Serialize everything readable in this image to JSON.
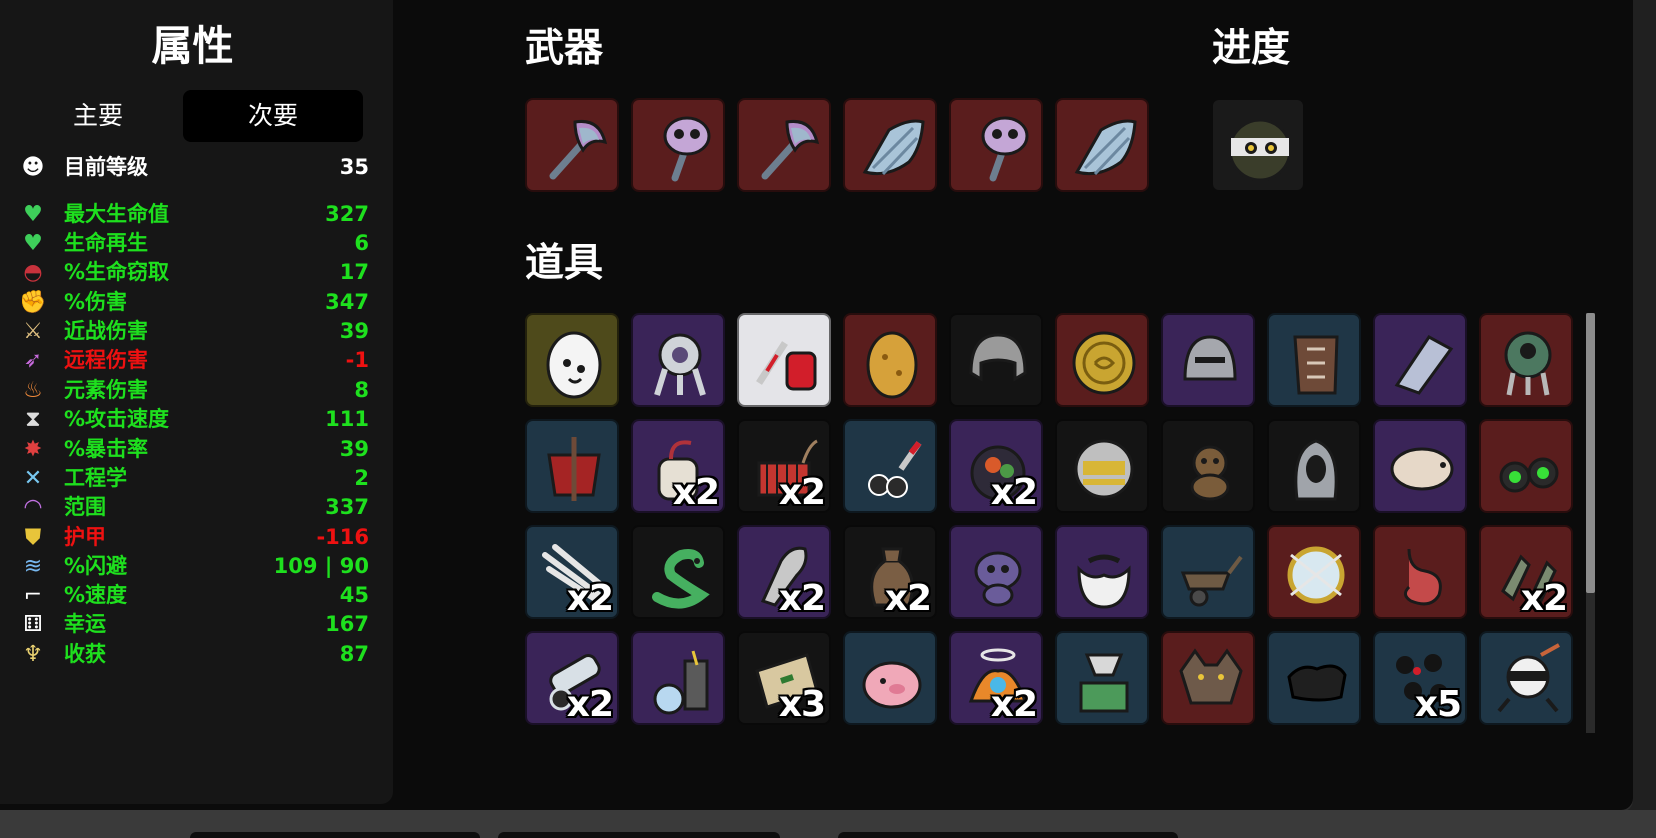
{
  "stats": {
    "title": "属性",
    "tabs": {
      "primary": "主要",
      "secondary": "次要"
    },
    "rows": [
      {
        "label": "目前等级",
        "value": "35",
        "color": "#ffffff",
        "value_color": "#ffffff",
        "icon": "level-up-icon"
      },
      {
        "label": "最大生命值",
        "value": "327",
        "color": "#1ee01e",
        "value_color": "#1ee01e",
        "icon": "heart-icon"
      },
      {
        "label": "生命再生",
        "value": "6",
        "color": "#1ee01e",
        "value_color": "#1ee01e",
        "icon": "heart-plus-icon"
      },
      {
        "label": "%生命窃取",
        "value": "17",
        "color": "#1ee01e",
        "value_color": "#1ee01e",
        "icon": "fangs-icon"
      },
      {
        "label": "%伤害",
        "value": "347",
        "color": "#1ee01e",
        "value_color": "#1ee01e",
        "icon": "fist-icon"
      },
      {
        "label": "近战伤害",
        "value": "39",
        "color": "#1ee01e",
        "value_color": "#1ee01e",
        "icon": "sword-icon"
      },
      {
        "label": "远程伤害",
        "value": "-1",
        "color": "#ee1111",
        "value_color": "#ee1111",
        "icon": "bow-icon"
      },
      {
        "label": "元素伤害",
        "value": "8",
        "color": "#1ee01e",
        "value_color": "#1ee01e",
        "icon": "flame-icon"
      },
      {
        "label": "%攻击速度",
        "value": "111",
        "color": "#1ee01e",
        "value_color": "#1ee01e",
        "icon": "hourglass-icon"
      },
      {
        "label": "%暴击率",
        "value": "39",
        "color": "#1ee01e",
        "value_color": "#1ee01e",
        "icon": "crit-burst-icon"
      },
      {
        "label": "工程学",
        "value": "2",
        "color": "#1ee01e",
        "value_color": "#1ee01e",
        "icon": "wrench-icon"
      },
      {
        "label": "范围",
        "value": "337",
        "color": "#1ee01e",
        "value_color": "#1ee01e",
        "icon": "range-waves-icon"
      },
      {
        "label": "护甲",
        "value": "-116",
        "color": "#ee1111",
        "value_color": "#ee1111",
        "icon": "shield-icon"
      },
      {
        "label": "%闪避",
        "value": "109 | 90",
        "color": "#1ee01e",
        "value_color": "#1ee01e",
        "icon": "dodge-wind-icon"
      },
      {
        "label": "%速度",
        "value": "45",
        "color": "#1ee01e",
        "value_color": "#1ee01e",
        "icon": "boot-icon"
      },
      {
        "label": "幸运",
        "value": "167",
        "color": "#1ee01e",
        "value_color": "#1ee01e",
        "icon": "dice-icon"
      },
      {
        "label": "收获",
        "value": "87",
        "color": "#1ee01e",
        "value_color": "#1ee01e",
        "icon": "harvest-wheat-icon"
      }
    ]
  },
  "weapons": {
    "title": "武器",
    "items": [
      {
        "icon": "axe-icon",
        "tier_color": "#5a1d1d"
      },
      {
        "icon": "skull-mace-icon",
        "tier_color": "#5a1d1d"
      },
      {
        "icon": "axe-icon",
        "tier_color": "#5a1d1d"
      },
      {
        "icon": "crystal-shard-icon",
        "tier_color": "#5a1d1d"
      },
      {
        "icon": "skull-mace-icon",
        "tier_color": "#5a1d1d"
      },
      {
        "icon": "crystal-shard-icon",
        "tier_color": "#5a1d1d"
      }
    ]
  },
  "progress": {
    "title": "进度",
    "items": [
      {
        "icon": "ninja-character-icon",
        "tier_color": "#1a1a1a"
      }
    ]
  },
  "items": {
    "title": "道具",
    "list": [
      {
        "icon": "egg-icon",
        "tier_color": "#4e4a1b",
        "count": ""
      },
      {
        "icon": "robot-droid-icon",
        "tier_color": "#3a2458",
        "count": ""
      },
      {
        "icon": "blood-bag-syringe-icon",
        "tier_color": "#e4e4e8",
        "count": ""
      },
      {
        "icon": "potato-icon",
        "tier_color": "#5a1d1d",
        "count": ""
      },
      {
        "icon": "helmet-icon",
        "tier_color": "#141414",
        "count": ""
      },
      {
        "icon": "gold-coin-icon",
        "tier_color": "#5a1d1d",
        "count": ""
      },
      {
        "icon": "knight-helmet-icon",
        "tier_color": "#3a2458",
        "count": ""
      },
      {
        "icon": "leather-armor-icon",
        "tier_color": "#1f3646",
        "count": ""
      },
      {
        "icon": "blade-shard-icon",
        "tier_color": "#3a2458",
        "count": ""
      },
      {
        "icon": "alien-droid-icon",
        "tier_color": "#5a1d1d",
        "count": ""
      },
      {
        "icon": "scarecrow-icon",
        "tier_color": "#1f3646",
        "count": ""
      },
      {
        "icon": "bandage-roll-icon",
        "tier_color": "#3a2458",
        "count": "x2"
      },
      {
        "icon": "dynamite-icon",
        "tier_color": "#141414",
        "count": "x2"
      },
      {
        "icon": "cherry-knife-icon",
        "tier_color": "#1f3646",
        "count": ""
      },
      {
        "icon": "fruit-bowl-icon",
        "tier_color": "#3a2458",
        "count": "x2"
      },
      {
        "icon": "golden-mask-icon",
        "tier_color": "#141414",
        "count": ""
      },
      {
        "icon": "monkey-icon",
        "tier_color": "#141414",
        "count": ""
      },
      {
        "icon": "hooded-alien-icon",
        "tier_color": "#141414",
        "count": ""
      },
      {
        "icon": "tardigrade-icon",
        "tier_color": "#3a2458",
        "count": ""
      },
      {
        "icon": "binoculars-icon",
        "tier_color": "#5a1d1d",
        "count": ""
      },
      {
        "icon": "claw-slash-icon",
        "tier_color": "#1f3646",
        "count": "x2"
      },
      {
        "icon": "snake-icon",
        "tier_color": "#141414",
        "count": ""
      },
      {
        "icon": "bullet-icon",
        "tier_color": "#3a2458",
        "count": "x2"
      },
      {
        "icon": "sack-icon",
        "tier_color": "#141414",
        "count": "x2"
      },
      {
        "icon": "baby-alien-icon",
        "tier_color": "#3a2458",
        "count": ""
      },
      {
        "icon": "beard-icon",
        "tier_color": "#3a2458",
        "count": ""
      },
      {
        "icon": "wheelbarrow-icon",
        "tier_color": "#1f3646",
        "count": ""
      },
      {
        "icon": "pierced-orb-icon",
        "tier_color": "#5a1d1d",
        "count": ""
      },
      {
        "icon": "stomach-icon",
        "tier_color": "#5a1d1d",
        "count": ""
      },
      {
        "icon": "rockets-icon",
        "tier_color": "#5a1d1d",
        "count": "x2"
      },
      {
        "icon": "cannon-icon",
        "tier_color": "#3a2458",
        "count": "x2"
      },
      {
        "icon": "alchemy-lab-icon",
        "tier_color": "#3a2458",
        "count": ""
      },
      {
        "icon": "treasure-map-icon",
        "tier_color": "#141414",
        "count": "x3"
      },
      {
        "icon": "piggy-bank-icon",
        "tier_color": "#1f3646",
        "count": ""
      },
      {
        "icon": "angel-droid-icon",
        "tier_color": "#3a2458",
        "count": "x2"
      },
      {
        "icon": "meat-grinder-icon",
        "tier_color": "#1f3646",
        "count": ""
      },
      {
        "icon": "werewolf-icon",
        "tier_color": "#5a1d1d",
        "count": ""
      },
      {
        "icon": "black-cloth-icon",
        "tier_color": "#1f3646",
        "count": ""
      },
      {
        "icon": "bombs-icon",
        "tier_color": "#1f3646",
        "count": "x5"
      },
      {
        "icon": "ninja-robot-icon",
        "tier_color": "#1f3646",
        "count": ""
      }
    ]
  }
}
